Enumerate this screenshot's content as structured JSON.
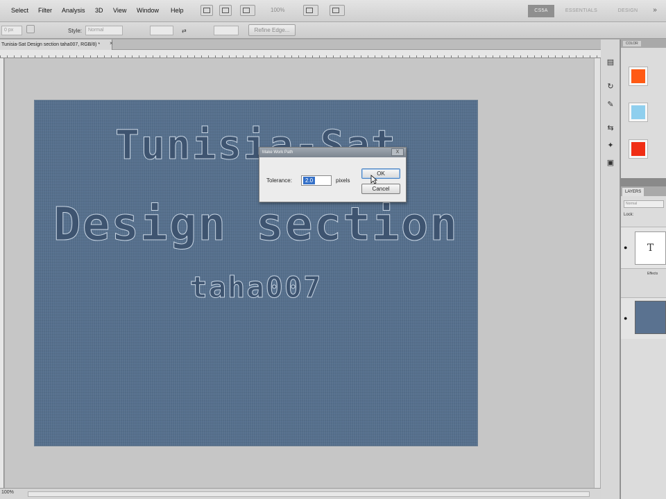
{
  "menu": {
    "items": [
      "Select",
      "Filter",
      "Analysis",
      "3D",
      "View",
      "Window",
      "Help"
    ],
    "zoom": "100%"
  },
  "workspaces": {
    "items": [
      "CS5A",
      "ESSENTIALS",
      "DESIGN"
    ],
    "active": "CS5A"
  },
  "options_bar": {
    "feather_value": "0 px",
    "style_label": "Style:",
    "style_value": "Normal",
    "refine_edge": "Refine Edge..."
  },
  "document": {
    "tab_title": "Tunisia-Sat Design section taha007, RGB/8) *",
    "close": "×"
  },
  "artwork": {
    "line1": "Tunisia-Sat",
    "line2": "Design section",
    "line3": "taha007"
  },
  "dialog": {
    "title": "Make Work Path",
    "close": "X",
    "tolerance_label": "Tolerance:",
    "tolerance_value": "2.0",
    "unit": "pixels",
    "ok": "OK",
    "cancel": "Cancel"
  },
  "status": {
    "zoom": "100%"
  },
  "panels": {
    "color_tab": "COLOR",
    "layers_tab": "LAYERS",
    "blend_mode": "Normal",
    "lock_label": "Lock:",
    "text_layer_glyph": "T",
    "effects_label": "Effects",
    "swatch_colors": [
      "#ff5a14",
      "#8fcfee",
      "#f02d14"
    ]
  }
}
